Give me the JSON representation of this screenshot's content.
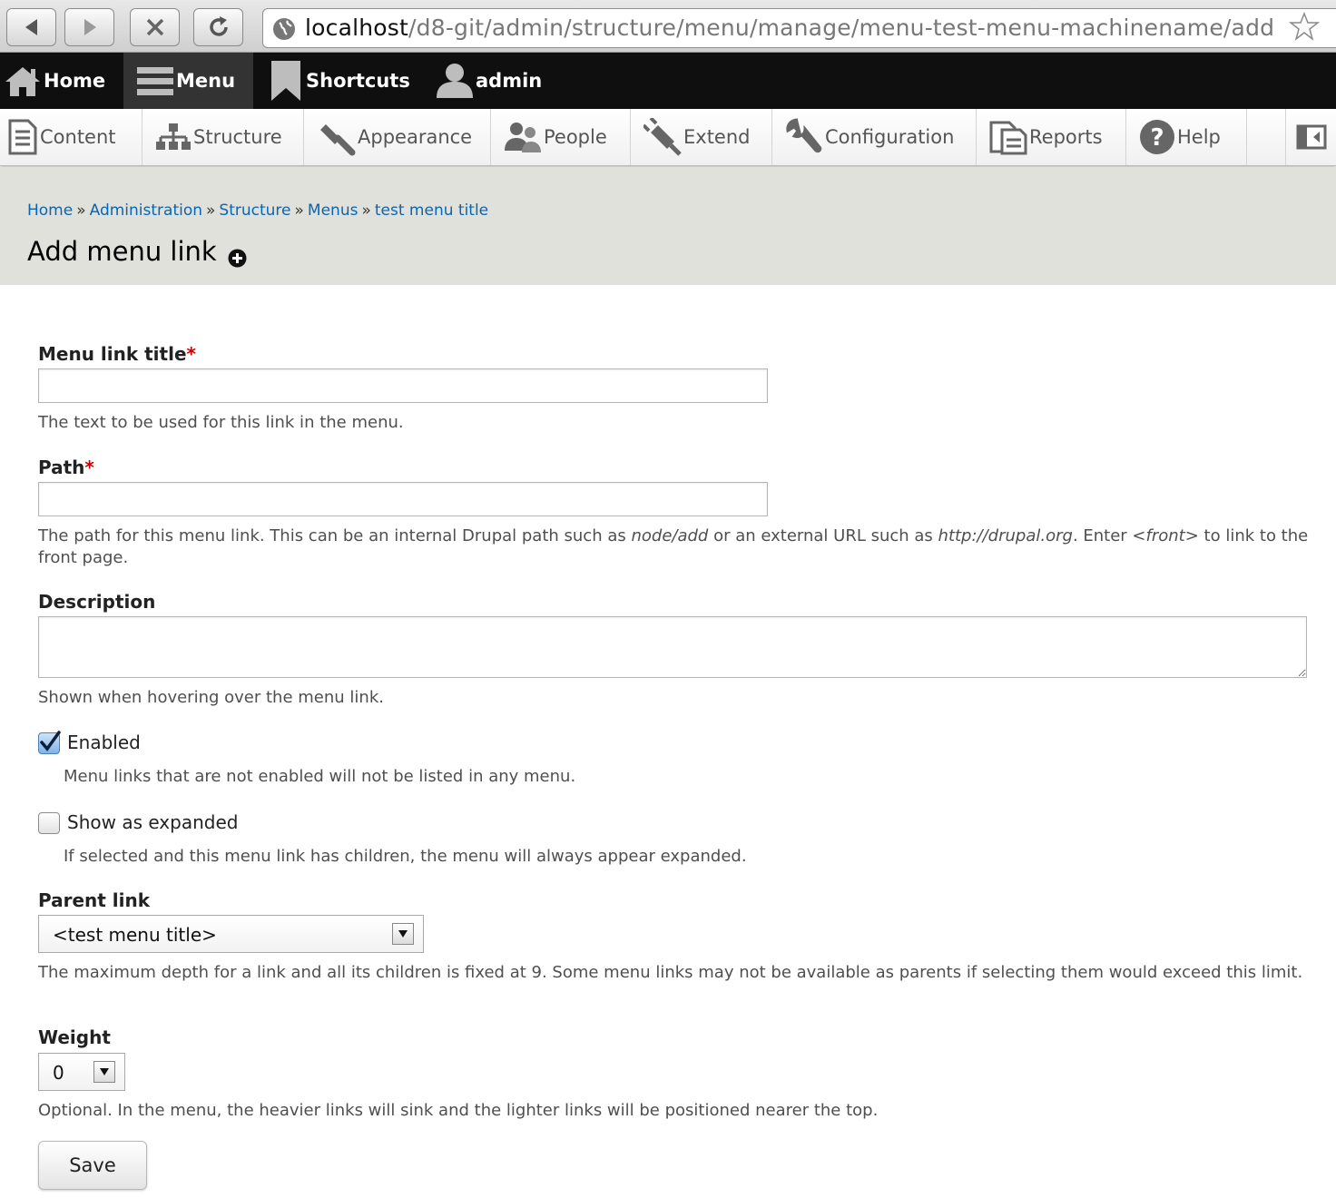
{
  "browser": {
    "url_host": "localhost",
    "url_path": "/d8-git/admin/structure/menu/manage/menu-test-menu-machinename/add"
  },
  "toolbar": {
    "items": [
      {
        "label": "Home",
        "icon": "home-icon"
      },
      {
        "label": "Menu",
        "icon": "hamburger-icon",
        "active": true
      },
      {
        "label": "Shortcuts",
        "icon": "bookmark-icon"
      },
      {
        "label": "admin",
        "icon": "user-icon"
      }
    ]
  },
  "tray": {
    "items": [
      {
        "label": "Content",
        "icon": "document-icon"
      },
      {
        "label": "Structure",
        "icon": "sitemap-icon"
      },
      {
        "label": "Appearance",
        "icon": "brush-icon"
      },
      {
        "label": "People",
        "icon": "people-icon"
      },
      {
        "label": "Extend",
        "icon": "plug-icon"
      },
      {
        "label": "Configuration",
        "icon": "wrench-icon"
      },
      {
        "label": "Reports",
        "icon": "reports-icon"
      },
      {
        "label": "Help",
        "icon": "help-icon"
      }
    ]
  },
  "breadcrumb": {
    "items": [
      "Home",
      "Administration",
      "Structure",
      "Menus",
      "test menu title"
    ],
    "separator": "»"
  },
  "page": {
    "title": "Add menu link"
  },
  "form": {
    "title": {
      "label": "Menu link title",
      "required": "*",
      "value": "",
      "help": "The text to be used for this link in the menu."
    },
    "path": {
      "label": "Path",
      "required": "*",
      "value": "",
      "help_1": "The path for this menu link. This can be an internal Drupal path such as ",
      "help_em_1": "node/add",
      "help_2": " or an external URL such as ",
      "help_em_2": "http://drupal.org",
      "help_3": ". Enter ",
      "help_em_3": "<front>",
      "help_4": " to link to the front page."
    },
    "description": {
      "label": "Description",
      "value": "",
      "help": "Shown when hovering over the menu link."
    },
    "enabled": {
      "label": "Enabled",
      "checked": true,
      "help": "Menu links that are not enabled will not be listed in any menu."
    },
    "expanded": {
      "label": "Show as expanded",
      "checked": false,
      "help": "If selected and this menu link has children, the menu will always appear expanded."
    },
    "parent": {
      "label": "Parent link",
      "value": "<test menu title>",
      "help": "The maximum depth for a link and all its children is fixed at 9. Some menu links may not be available as parents if selecting them would exceed this limit."
    },
    "weight": {
      "label": "Weight",
      "value": "0",
      "help": "Optional. In the menu, the heavier links will sink and the lighter links will be positioned nearer the top."
    },
    "save_label": "Save"
  },
  "colors": {
    "link": "#0a65b3",
    "toolbar_bg": "#0f0f0f",
    "header_band": "#e1e1db",
    "required": "#cc0000"
  }
}
